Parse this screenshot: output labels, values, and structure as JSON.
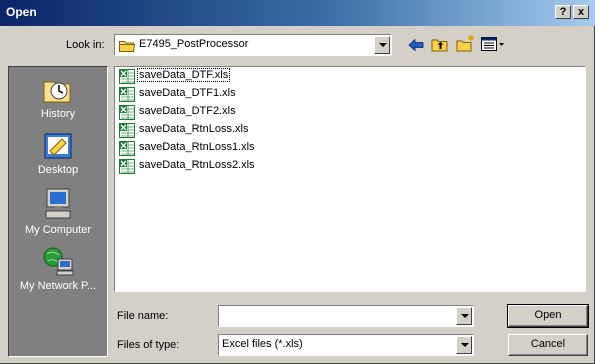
{
  "dialog": {
    "title": "Open",
    "help_button": "?",
    "close_button": "x"
  },
  "look_in": {
    "label": "Look in:",
    "value": "E7495_PostProcessor"
  },
  "places": [
    {
      "label": "History"
    },
    {
      "label": "Desktop"
    },
    {
      "label": "My Computer"
    },
    {
      "label": "My Network P..."
    }
  ],
  "files": [
    {
      "name": "saveData_DTF.xls",
      "selected": true
    },
    {
      "name": "saveData_DTF1.xls"
    },
    {
      "name": "saveData_DTF2.xls"
    },
    {
      "name": "saveData_RtnLoss.xls"
    },
    {
      "name": "saveData_RtnLoss1.xls"
    },
    {
      "name": "saveData_RtnLoss2.xls"
    }
  ],
  "file_name": {
    "label": "File name:",
    "value": ""
  },
  "file_type": {
    "label": "Files of type:",
    "value": "Excel files (*.xls)"
  },
  "buttons": {
    "open": "Open",
    "cancel": "Cancel"
  },
  "colors": {
    "title_bar": "#0a246a",
    "face": "#d4d0c8",
    "places_bar": "#808080",
    "excel_green": "#1f7a3a"
  }
}
